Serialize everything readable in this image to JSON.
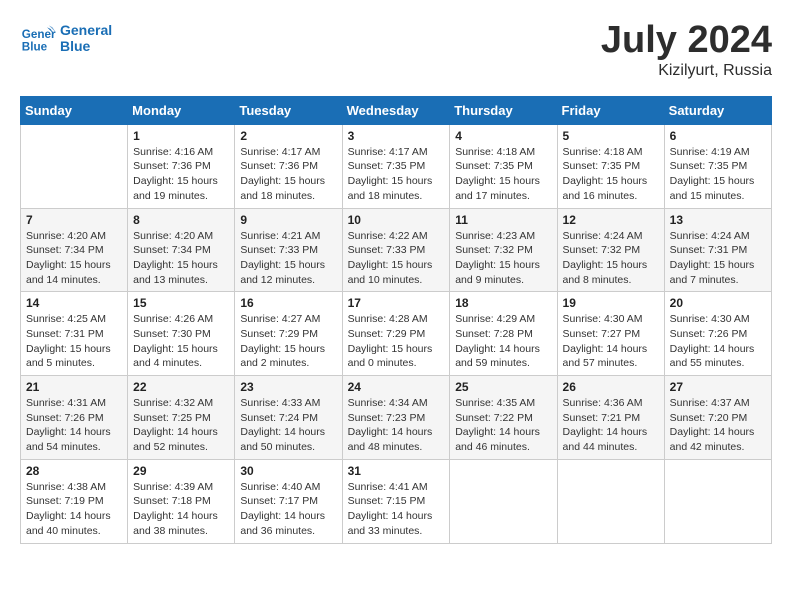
{
  "logo": {
    "line1": "General",
    "line2": "Blue"
  },
  "title": "July 2024",
  "location": "Kizilyurt, Russia",
  "days_header": [
    "Sunday",
    "Monday",
    "Tuesday",
    "Wednesday",
    "Thursday",
    "Friday",
    "Saturday"
  ],
  "weeks": [
    [
      {
        "day": "",
        "info": ""
      },
      {
        "day": "1",
        "info": "Sunrise: 4:16 AM\nSunset: 7:36 PM\nDaylight: 15 hours\nand 19 minutes."
      },
      {
        "day": "2",
        "info": "Sunrise: 4:17 AM\nSunset: 7:36 PM\nDaylight: 15 hours\nand 18 minutes."
      },
      {
        "day": "3",
        "info": "Sunrise: 4:17 AM\nSunset: 7:35 PM\nDaylight: 15 hours\nand 18 minutes."
      },
      {
        "day": "4",
        "info": "Sunrise: 4:18 AM\nSunset: 7:35 PM\nDaylight: 15 hours\nand 17 minutes."
      },
      {
        "day": "5",
        "info": "Sunrise: 4:18 AM\nSunset: 7:35 PM\nDaylight: 15 hours\nand 16 minutes."
      },
      {
        "day": "6",
        "info": "Sunrise: 4:19 AM\nSunset: 7:35 PM\nDaylight: 15 hours\nand 15 minutes."
      }
    ],
    [
      {
        "day": "7",
        "info": "Sunrise: 4:20 AM\nSunset: 7:34 PM\nDaylight: 15 hours\nand 14 minutes."
      },
      {
        "day": "8",
        "info": "Sunrise: 4:20 AM\nSunset: 7:34 PM\nDaylight: 15 hours\nand 13 minutes."
      },
      {
        "day": "9",
        "info": "Sunrise: 4:21 AM\nSunset: 7:33 PM\nDaylight: 15 hours\nand 12 minutes."
      },
      {
        "day": "10",
        "info": "Sunrise: 4:22 AM\nSunset: 7:33 PM\nDaylight: 15 hours\nand 10 minutes."
      },
      {
        "day": "11",
        "info": "Sunrise: 4:23 AM\nSunset: 7:32 PM\nDaylight: 15 hours\nand 9 minutes."
      },
      {
        "day": "12",
        "info": "Sunrise: 4:24 AM\nSunset: 7:32 PM\nDaylight: 15 hours\nand 8 minutes."
      },
      {
        "day": "13",
        "info": "Sunrise: 4:24 AM\nSunset: 7:31 PM\nDaylight: 15 hours\nand 7 minutes."
      }
    ],
    [
      {
        "day": "14",
        "info": "Sunrise: 4:25 AM\nSunset: 7:31 PM\nDaylight: 15 hours\nand 5 minutes."
      },
      {
        "day": "15",
        "info": "Sunrise: 4:26 AM\nSunset: 7:30 PM\nDaylight: 15 hours\nand 4 minutes."
      },
      {
        "day": "16",
        "info": "Sunrise: 4:27 AM\nSunset: 7:29 PM\nDaylight: 15 hours\nand 2 minutes."
      },
      {
        "day": "17",
        "info": "Sunrise: 4:28 AM\nSunset: 7:29 PM\nDaylight: 15 hours\nand 0 minutes."
      },
      {
        "day": "18",
        "info": "Sunrise: 4:29 AM\nSunset: 7:28 PM\nDaylight: 14 hours\nand 59 minutes."
      },
      {
        "day": "19",
        "info": "Sunrise: 4:30 AM\nSunset: 7:27 PM\nDaylight: 14 hours\nand 57 minutes."
      },
      {
        "day": "20",
        "info": "Sunrise: 4:30 AM\nSunset: 7:26 PM\nDaylight: 14 hours\nand 55 minutes."
      }
    ],
    [
      {
        "day": "21",
        "info": "Sunrise: 4:31 AM\nSunset: 7:26 PM\nDaylight: 14 hours\nand 54 minutes."
      },
      {
        "day": "22",
        "info": "Sunrise: 4:32 AM\nSunset: 7:25 PM\nDaylight: 14 hours\nand 52 minutes."
      },
      {
        "day": "23",
        "info": "Sunrise: 4:33 AM\nSunset: 7:24 PM\nDaylight: 14 hours\nand 50 minutes."
      },
      {
        "day": "24",
        "info": "Sunrise: 4:34 AM\nSunset: 7:23 PM\nDaylight: 14 hours\nand 48 minutes."
      },
      {
        "day": "25",
        "info": "Sunrise: 4:35 AM\nSunset: 7:22 PM\nDaylight: 14 hours\nand 46 minutes."
      },
      {
        "day": "26",
        "info": "Sunrise: 4:36 AM\nSunset: 7:21 PM\nDaylight: 14 hours\nand 44 minutes."
      },
      {
        "day": "27",
        "info": "Sunrise: 4:37 AM\nSunset: 7:20 PM\nDaylight: 14 hours\nand 42 minutes."
      }
    ],
    [
      {
        "day": "28",
        "info": "Sunrise: 4:38 AM\nSunset: 7:19 PM\nDaylight: 14 hours\nand 40 minutes."
      },
      {
        "day": "29",
        "info": "Sunrise: 4:39 AM\nSunset: 7:18 PM\nDaylight: 14 hours\nand 38 minutes."
      },
      {
        "day": "30",
        "info": "Sunrise: 4:40 AM\nSunset: 7:17 PM\nDaylight: 14 hours\nand 36 minutes."
      },
      {
        "day": "31",
        "info": "Sunrise: 4:41 AM\nSunset: 7:15 PM\nDaylight: 14 hours\nand 33 minutes."
      },
      {
        "day": "",
        "info": ""
      },
      {
        "day": "",
        "info": ""
      },
      {
        "day": "",
        "info": ""
      }
    ]
  ]
}
